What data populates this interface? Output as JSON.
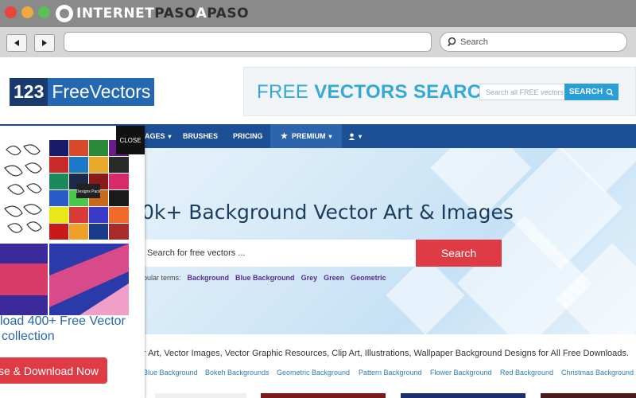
{
  "window": {
    "brand_part1": "INTERNET",
    "brand_part2": "PASO",
    "brand_part3": "A",
    "brand_part4": "PASO"
  },
  "browser": {
    "search_placeholder": "Search"
  },
  "site": {
    "logo_number": "123",
    "logo_word": "FreeVectors",
    "header_search_title_light": "FREE ",
    "header_search_title_bold": "VECTORS SEARCH",
    "header_search_placeholder": "Search all FREE vectors",
    "header_search_button": "SEARCH"
  },
  "nav": {
    "items": [
      "AGES",
      "BRUSHES",
      "PRICING",
      "PREMIUM"
    ],
    "accent": "#1c4f93"
  },
  "hero": {
    "title": "0k+ Background Vector Art & Images",
    "search_placeholder": "Search for free vectors ...",
    "search_button": "Search",
    "popular_label": "opular terms:",
    "popular_terms": [
      "Background",
      "Blue Background",
      "Grey",
      "Green",
      "Geometric"
    ]
  },
  "description": "r Art, Vector Images, Vector Graphic Resources, Clip Art, Illustrations, Wallpaper Background Designs for All Free Downloads.",
  "related_tags": [
    "Blue Background",
    "Bokeh Backgrounds",
    "Geometric Background",
    "Pattern Background",
    "Flower Background",
    "Red Background",
    "Christmas Background"
  ],
  "modal": {
    "close_label": "CLOSE",
    "promo_line1": "load 400+ Free Vector",
    "promo_line2": "collection",
    "download_button": "se & Download Now",
    "promo_label": "Designs Pack"
  },
  "colors": {
    "brand_blue": "#2468b2",
    "action_red": "#de3b44",
    "link": "#2a7fb8"
  }
}
